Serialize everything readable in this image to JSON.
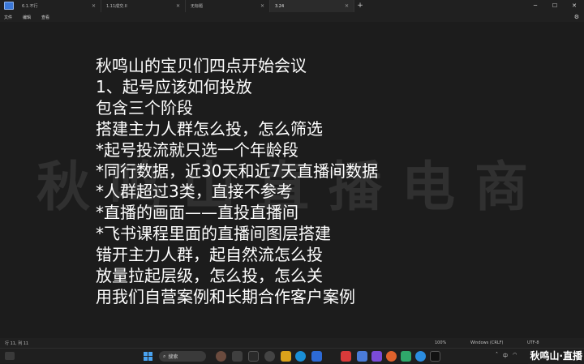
{
  "window": {
    "tabs": [
      {
        "label": "6.1.不行",
        "active": false
      },
      {
        "label": "1.11成交.II",
        "active": false
      },
      {
        "label": "无标题",
        "active": false
      },
      {
        "label": "3.24",
        "active": true
      }
    ],
    "new_tab_label": "+"
  },
  "menu": {
    "items": [
      "文件",
      "编辑",
      "查看"
    ]
  },
  "document": {
    "lines": [
      "秋鸣山的宝贝们四点开始会议",
      "1、起号应该如何投放",
      "包含三个阶段",
      "搭建主力人群怎么投，怎么筛选",
      "*起号投流就只选一个年龄段",
      "*同行数据，近30天和近7天直播间数据",
      "*人群超过3类，直接不参考",
      "*直播的画面——直投直播间",
      "*飞书课程里面的直播间图层搭建",
      "错开主力人群，起自然流怎么投",
      "放量拉起层级，怎么投，怎么关",
      "用我们自营案例和长期合作客户案例"
    ],
    "watermark": "秋鸣山直播电商"
  },
  "status": {
    "position": "行 11, 列 11",
    "zoom": "100%",
    "line_ending": "Windows (CRLF)",
    "encoding": "UTF-8"
  },
  "taskbar": {
    "search_label": "搜索",
    "tray_lang": "中",
    "brand": "秋鸣山·直播"
  },
  "colors": {
    "accent": "#49a3f1",
    "background": "#1c1c1c",
    "text": "#ffffff"
  }
}
